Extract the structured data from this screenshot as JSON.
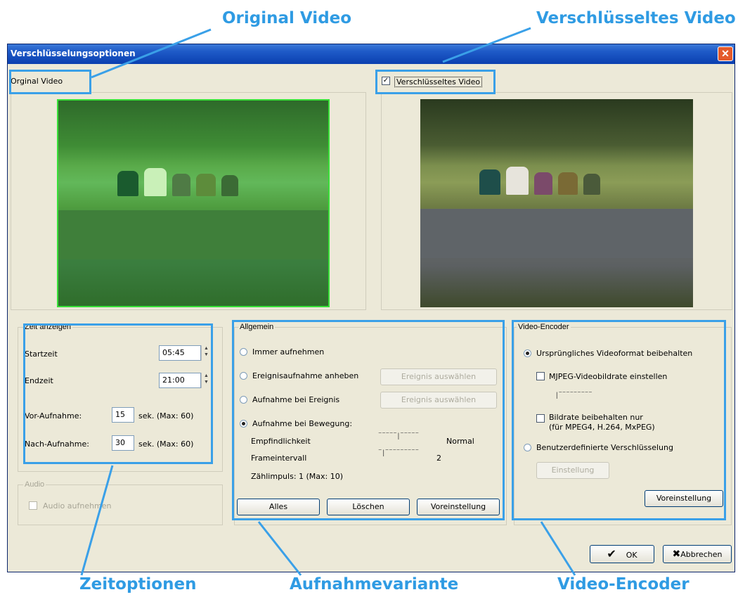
{
  "callouts": {
    "original_video": "Original Video",
    "encrypted_video": "Verschlüsseltes Video",
    "time_options": "Zeitoptionen",
    "recording_mode": "Aufnahmevariante",
    "video_encoder": "Video-Encoder"
  },
  "colors": {
    "callout_text": "#2f9be3",
    "callout_line": "#3aa0e8",
    "titlebar": "#0a3fb0",
    "dialog_bg": "#ece9d8"
  },
  "window": {
    "title": "Verschlüsselungsoptionen",
    "close_icon": "close-icon"
  },
  "preview": {
    "original_label": "Orginal Video",
    "encrypted_label": "Verschlüsseltes Video",
    "encrypted_checked": true
  },
  "time": {
    "group_label": "Zeit anzeigen",
    "start_label": "Startzeit",
    "start_value": "05:45",
    "end_label": "Endzeit",
    "end_value": "21:00",
    "pre_label": "Vor-Aufnahme:",
    "pre_value": "15",
    "pre_unit": "sek. (Max: 60)",
    "post_label": "Nach-Aufnahme:",
    "post_value": "30",
    "post_unit": "sek. (Max: 60)"
  },
  "audio": {
    "group_label": "Audio",
    "record_label": "Audio aufnehmen"
  },
  "general": {
    "group_label": "Allgemein",
    "always": "Immer aufnehmen",
    "raise_event": "Ereignisaufnahme anheben",
    "on_event": "Aufnahme bei Ereignis",
    "on_motion": "Aufnahme bei Bewegung:",
    "select_event_1": "Ereignis auswählen",
    "select_event_2": "Ereignis auswählen",
    "sensitivity_label": "Empfindlichkeit",
    "sensitivity_value": "Normal",
    "frame_interval_label": "Frameintervall",
    "frame_interval_value": "2",
    "count_label": "Zählimpuls: 1 (Max: 10)",
    "btn_all": "Alles",
    "btn_delete": "Löschen",
    "btn_default": "Voreinstellung",
    "selected": "on_motion"
  },
  "encoder": {
    "group_label": "Video-Encoder",
    "keep_format": "Ursprüngliches Videoformat beibehalten",
    "mjpeg_rate": "MJPEG-Videobildrate einstellen",
    "keep_rate_line1": "Bildrate beibehalten nur",
    "keep_rate_line2": "(für MPEG4, H.264, MxPEG)",
    "custom": "Benutzerdefinierte Verschlüsselung",
    "settings_btn": "Einstellung",
    "default_btn": "Voreinstellung",
    "selected": "keep_format"
  },
  "footer": {
    "ok": "OK",
    "cancel": "Abbrechen"
  }
}
